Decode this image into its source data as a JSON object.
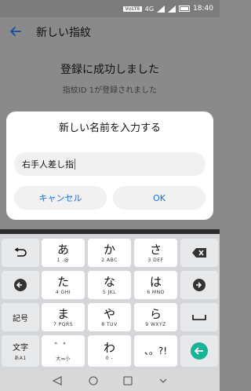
{
  "status_bar": {
    "network_badge": "VoLTE",
    "signal_label": "4G",
    "time": "18:40"
  },
  "app_bar": {
    "title": "新しい指紋"
  },
  "content": {
    "success_title": "登録に成功しました",
    "success_sub": "指紋ID 1が登録されました"
  },
  "dialog": {
    "title": "新しい名前を入力する",
    "input_value": "右手人差し指",
    "cancel_label": "キャンセル",
    "ok_label": "OK"
  },
  "keyboard": {
    "rows": [
      {
        "left": "undo",
        "keys": [
          {
            "main": "あ",
            "sub": "1 .@"
          },
          {
            "main": "か",
            "sub": "2 ABC"
          },
          {
            "main": "さ",
            "sub": "3 DEF"
          }
        ],
        "right": "backspace"
      },
      {
        "left": "left",
        "keys": [
          {
            "main": "た",
            "sub": "4 GHI"
          },
          {
            "main": "な",
            "sub": "5 JKL"
          },
          {
            "main": "は",
            "sub": "6 MNO"
          }
        ],
        "right": "right"
      },
      {
        "left_label": "記号",
        "keys": [
          {
            "main": "ま",
            "sub": "7 PQRS"
          },
          {
            "main": "や",
            "sub": "8 TUV"
          },
          {
            "main": "ら",
            "sub": "9 WXYZ"
          }
        ],
        "right": "space"
      },
      {
        "left_label": "文字",
        "left_sub": "あA1",
        "keys": [
          {
            "main": "゛゜",
            "sub": "大⇔小"
          },
          {
            "main": "わ",
            "sub": "0 -"
          },
          {
            "main": "、。?!",
            "sub": ""
          }
        ],
        "right": "enter"
      }
    ]
  },
  "colors": {
    "accent": "#1a6fe0",
    "enter": "#19b396",
    "scrim": "#8a8a8a"
  }
}
